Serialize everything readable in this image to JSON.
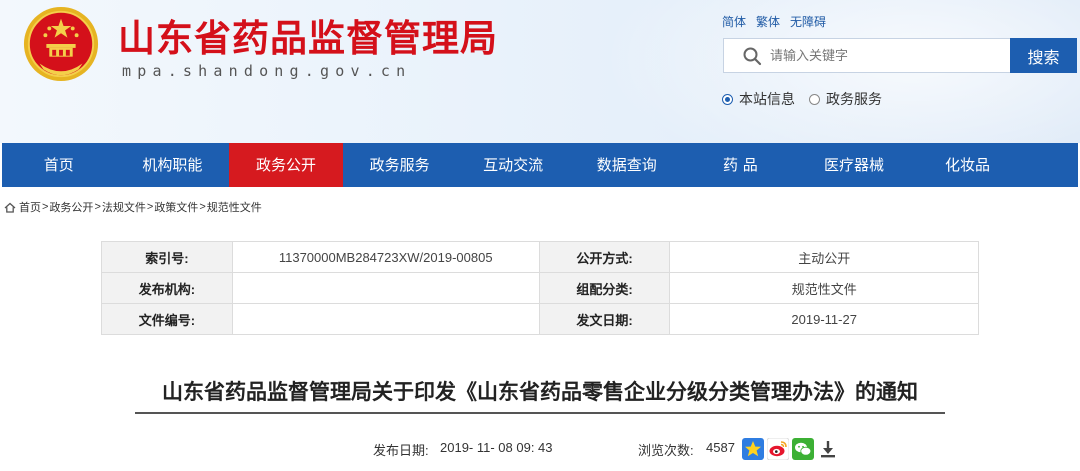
{
  "site": {
    "title": "山东省药品监督管理局",
    "domain": "mpa.shandong.gov.cn",
    "emblem_icon": "national-emblem-icon",
    "brand_red": "#d4101a",
    "brand_blue": "#1d5eb0"
  },
  "lang_links": [
    "简体",
    "繁体",
    "无障碍"
  ],
  "search": {
    "placeholder": "请输入关键字",
    "button_label": "搜索",
    "scopes": [
      {
        "label": "本站信息",
        "selected": true
      },
      {
        "label": "政务服务",
        "selected": false
      }
    ]
  },
  "nav": {
    "items": [
      "首页",
      "机构职能",
      "政务公开",
      "政务服务",
      "互动交流",
      "数据查询",
      "药 品",
      "医疗器械",
      "化妆品"
    ],
    "active_index": 2,
    "active_color": "#d61a1f"
  },
  "breadcrumb": [
    "首页",
    "政务公开",
    "法规文件",
    "政策文件",
    "规范性文件"
  ],
  "breadcrumb_separator": ">",
  "meta": {
    "rows": [
      {
        "k1": "索引号:",
        "v1": "11370000MB284723XW/2019-00805",
        "k2": "公开方式:",
        "v2": "主动公开"
      },
      {
        "k1": "发布机构:",
        "v1": "",
        "k2": "组配分类:",
        "v2": "规范性文件"
      },
      {
        "k1": "文件编号:",
        "v1": "",
        "k2": "发文日期:",
        "v2": "2019-11-27"
      }
    ]
  },
  "article": {
    "title": "山东省药品监督管理局关于印发《山东省药品零售企业分级分类管理办法》的通知",
    "publish_label": "发布日期:",
    "publish_date": "2019- 11- 08 09: 43",
    "views_label": "浏览次数:",
    "views_value": "4587",
    "share_icons": [
      "favorite-star-icon",
      "weibo-icon",
      "wechat-icon",
      "download-icon"
    ]
  }
}
